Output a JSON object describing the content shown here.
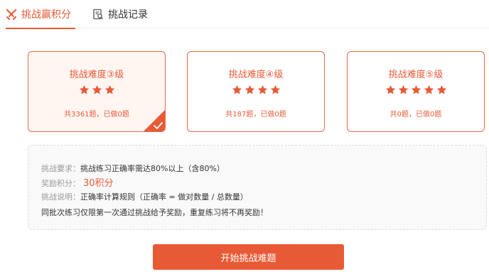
{
  "tabs": [
    {
      "label": "挑战赢积分",
      "icon": "swords-icon",
      "active": true
    },
    {
      "label": "挑战记录",
      "icon": "record-search-icon",
      "active": false
    }
  ],
  "cards": [
    {
      "title": "挑战难度③级",
      "stars": 3,
      "count": "共3361题，已做0题",
      "selected": true
    },
    {
      "title": "挑战难度④级",
      "stars": 4,
      "count": "共187题，已做0题",
      "selected": false
    },
    {
      "title": "挑战难度⑤级",
      "stars": 5,
      "count": "共0题，已做0题",
      "selected": false
    }
  ],
  "info": {
    "requirement_label": "挑战要求：",
    "requirement_text": "挑战练习正确率需达80%以上（含80%）",
    "reward_label": "奖励积分：",
    "reward_value": "30积分",
    "note_label": "挑战说明：",
    "note_text": "正确率计算规则（正确率 = 做对数量 / 总数量）",
    "note_extra": "同批次练习仅限第一次通过挑战给予奖励，重复练习将不再奖励！"
  },
  "start_button": "开始挑战难题",
  "colors": {
    "accent": "#e85a36",
    "selected_bg": "#fff6f2"
  }
}
